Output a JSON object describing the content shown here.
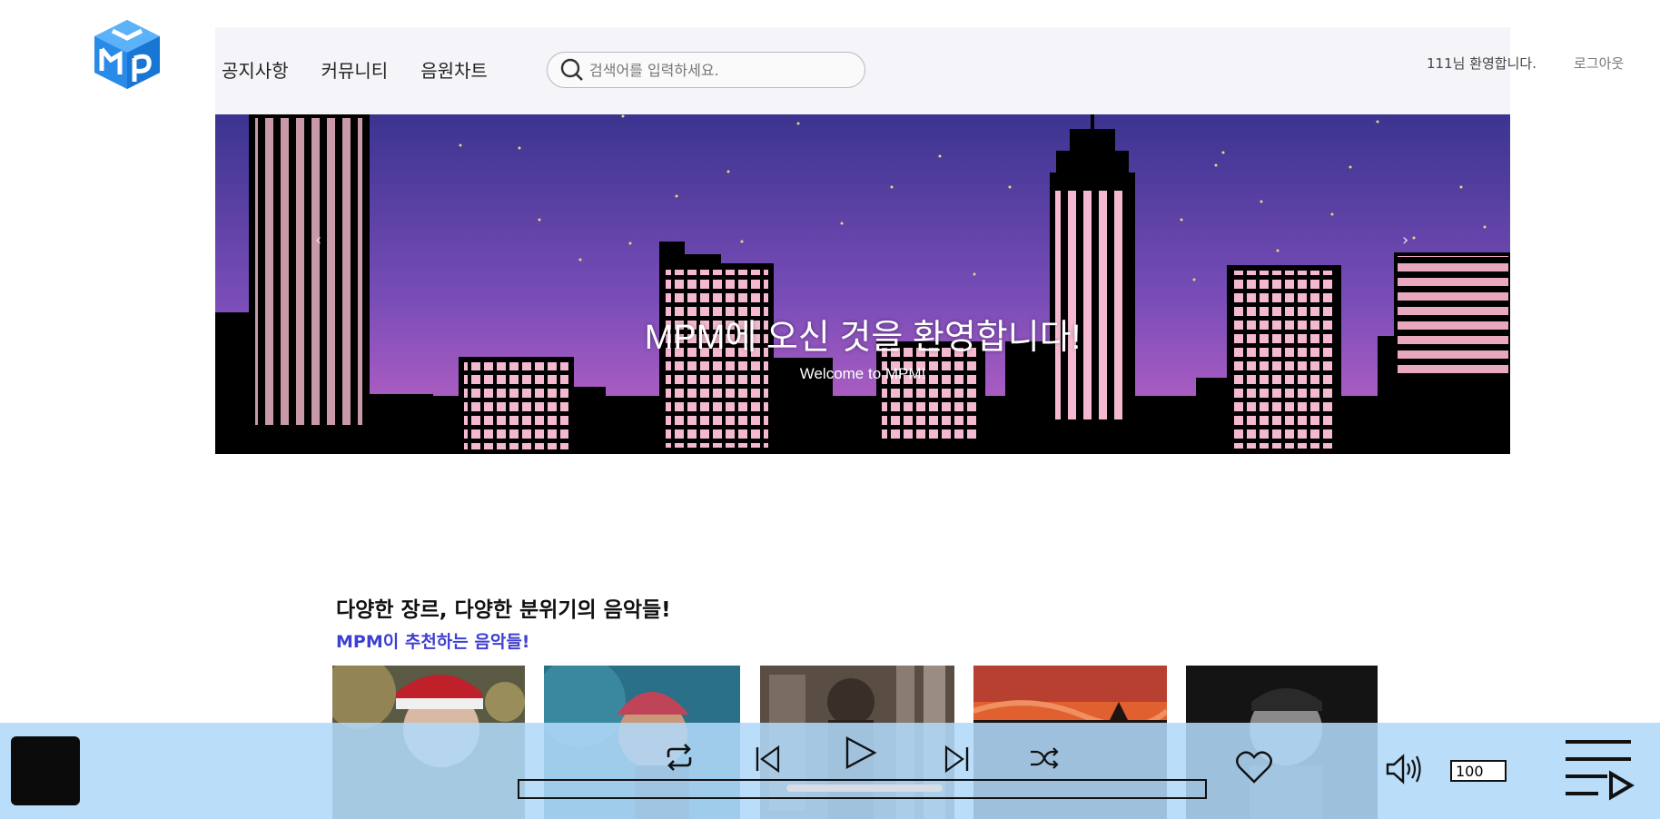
{
  "header": {
    "logo_name": "mpm-logo",
    "nav": [
      "공지사항",
      "커뮤니티",
      "음원차트"
    ],
    "search_placeholder": "검색어를 입력하세요.",
    "welcome": "111님 환영합니다.",
    "logout": "로그아웃"
  },
  "banner": {
    "title": "MPM에 오신 것을 환영합니다!",
    "subtitle": "Welcome to MPM!",
    "prev": "‹",
    "next": "›"
  },
  "section": {
    "title": "다양한 장르, 다양한 분위기의 음악들!",
    "subtitle": "MPM이 추천하는 음악들!"
  },
  "cards": [
    "card-santa",
    "card-beanie",
    "card-city",
    "card-sunset",
    "card-bw-portrait"
  ],
  "player": {
    "volume": "100",
    "progress": 0.45,
    "icons": [
      "repeat-icon",
      "previous-icon",
      "play-icon",
      "next-icon",
      "shuffle-icon",
      "heart-icon",
      "volume-icon",
      "playlist-icon"
    ]
  },
  "colors": {
    "accent": "#3f3fd0",
    "player_bg": "#b0d8f8",
    "sky_top": "#3b3490",
    "sky_bottom": "#b760c6",
    "window": "#f4b9d0"
  }
}
